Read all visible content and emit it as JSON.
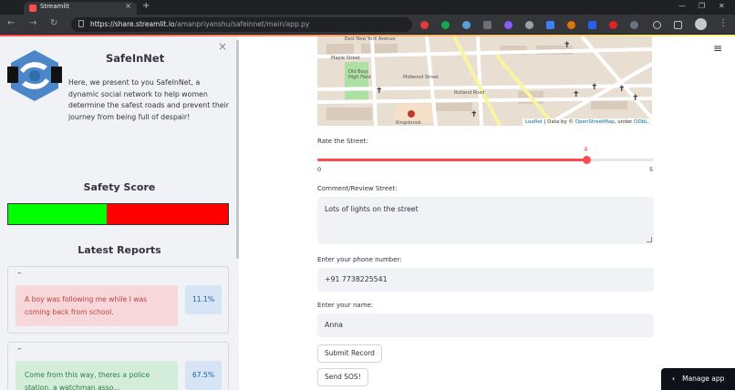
{
  "browser": {
    "tab_title": "Streamlit",
    "tab_close": "×",
    "new_tab": "+",
    "url_host": "https://share.streamlit.io",
    "url_path": "/amanpriyanshu/safeinnet/main/app.py",
    "min": "—",
    "restore": "❐",
    "close": "✕"
  },
  "sidebar": {
    "close": "×",
    "app_title": "SafeInNet",
    "description": "Here, we present to you SafeInNet, a dynamic social network to help women determine the safest roads and prevent their journey from being full of despair!",
    "safety_score_title": "Safety Score",
    "safety_score_percent": 45,
    "latest_reports_title": "Latest Reports",
    "reports": [
      {
        "dash": "–",
        "message": "A boy was following me while I was coming back from school.",
        "score": "11.1%",
        "tone": "red"
      },
      {
        "dash": "–",
        "message": "Come from this way, theres a police station, a watchman asso...",
        "score": "67.5%",
        "tone": "green"
      }
    ]
  },
  "map": {
    "labels": [
      "East New York Avenue",
      "Maple Street",
      "Midwood Street",
      "Rutland Road",
      "Kingsbrook",
      "Old Boys High Field"
    ],
    "attribution_leaflet": "Leaflet",
    "attribution_mid": "| Data by ©",
    "attribution_osm": "OpenStreetMap",
    "attribution_under": ", under",
    "attribution_odbl": "ODbL."
  },
  "form": {
    "rate_label": "Rate the Street:",
    "rate_value": 4,
    "rate_min": 0,
    "rate_max": 5,
    "comment_label": "Comment/Review Street:",
    "comment_value": "Lots of lights on the street",
    "phone_label": "Enter your phone number:",
    "phone_value": "+91 7738225541",
    "name_label": "Enter your name:",
    "name_value": "Anna",
    "submit_label": "Submit Record",
    "sos_label": "Send SOS!"
  },
  "footer": {
    "manage_app": "Manage app"
  }
}
